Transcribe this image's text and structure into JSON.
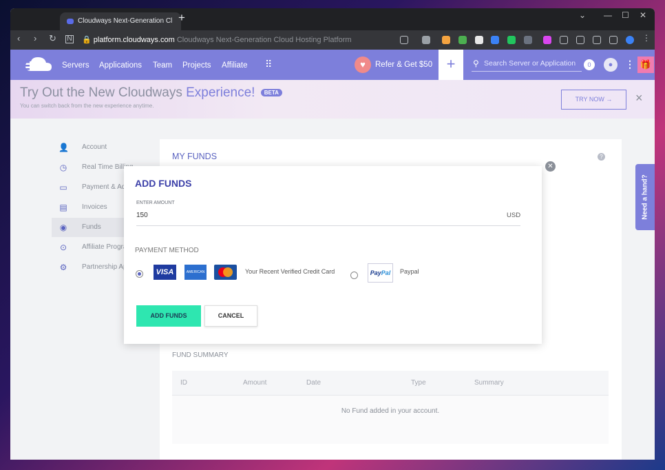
{
  "browser": {
    "tab_title": "Cloudways Next-Generation Cl",
    "new_tab": "+",
    "url_domain": "platform.cloudways.com",
    "url_title": "Cloudways Next-Generation Cloud Hosting Platform"
  },
  "nav": {
    "items": [
      "Servers",
      "Applications",
      "Team",
      "Projects",
      "Affiliate"
    ],
    "refer": "Refer & Get $50",
    "search_placeholder": "Search Server or Application",
    "notification_count": "0"
  },
  "banner": {
    "title_prefix": "Try Out the New Cloudways",
    "title_accent": "Experience!",
    "beta": "BETA",
    "subtitle": "You can switch back from the new experience anytime.",
    "try_now": "TRY NOW →"
  },
  "sidebar": {
    "items": [
      {
        "label": "Account",
        "icon": "user-icon"
      },
      {
        "label": "Real Time Billing",
        "icon": "clock-icon"
      },
      {
        "label": "Payment & Address",
        "icon": "credit-card-icon"
      },
      {
        "label": "Invoices",
        "icon": "invoice-icon"
      },
      {
        "label": "Funds",
        "icon": "coin-icon"
      },
      {
        "label": "Affiliate Program",
        "icon": "affiliate-icon"
      },
      {
        "label": "Partnership App",
        "icon": "partnership-icon"
      }
    ],
    "active_index": 4
  },
  "main": {
    "title": "MY FUNDS",
    "fund_summary": "FUND SUMMARY",
    "columns": [
      "ID",
      "Amount",
      "Date",
      "Type",
      "Summary"
    ],
    "empty_message": "No Fund added in your account."
  },
  "need_hand": "Need a hand?",
  "modal": {
    "title": "ADD FUNDS",
    "amount_label": "ENTER AMOUNT",
    "amount_value": "150",
    "currency": "USD",
    "payment_method_label": "PAYMENT METHOD",
    "card_option": "Your Recent Verified Credit Card",
    "paypal_option": "Paypal",
    "add_button": "ADD FUNDS",
    "cancel_button": "CANCEL",
    "selected_method": "card"
  },
  "colors": {
    "brand": "#7d7fdb",
    "accent_green": "#2ee6b0",
    "title_blue": "#3b3fa8"
  }
}
